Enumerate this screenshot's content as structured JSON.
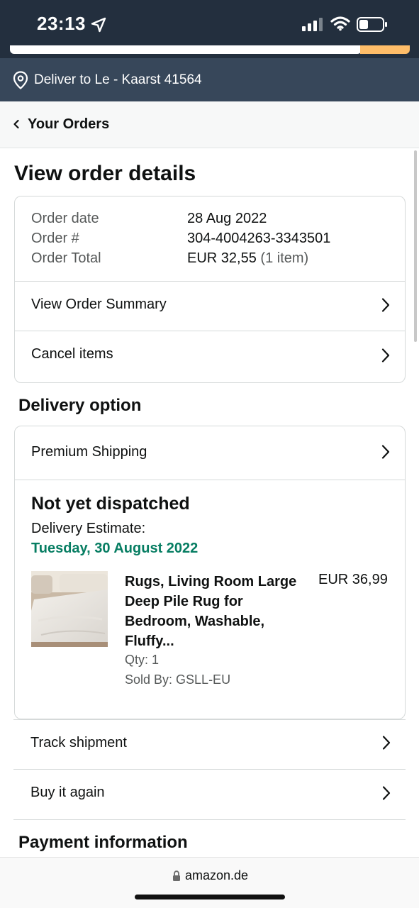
{
  "status_bar": {
    "time": "23:13"
  },
  "deliver": {
    "text": "Deliver to Le - Kaarst 41564"
  },
  "breadcrumb": {
    "label": "Your Orders"
  },
  "page": {
    "title": "View order details"
  },
  "order": {
    "date_label": "Order date",
    "date_value": "28 Aug 2022",
    "number_label": "Order #",
    "number_value": "304-4004263-3343501",
    "total_label": "Order Total",
    "total_value": "EUR 32,55",
    "total_items": "(1 item)",
    "view_summary": "View Order Summary",
    "cancel_items": "Cancel items"
  },
  "delivery": {
    "section_title": "Delivery option",
    "shipping": "Premium Shipping",
    "status": "Not yet dispatched",
    "estimate_label": "Delivery Estimate:",
    "estimate_date": "Tuesday, 30 August 2022",
    "estimate_color": "#067d62"
  },
  "product": {
    "title_line1": "Rugs, Living Room Large",
    "title_line2": "Deep Pile Rug for",
    "title_line3": "Bedroom, Washable,",
    "title_line4": "Fluffy...",
    "price": "EUR 36,99",
    "qty": "Qty: 1",
    "sold_by": "Sold By: GSLL-EU"
  },
  "actions": {
    "track": "Track shipment",
    "buy_again": "Buy it again"
  },
  "payment": {
    "section_title": "Payment information"
  },
  "browser": {
    "url": "amazon.de"
  },
  "colors": {
    "header_dark": "#232f3e",
    "deliver_bar": "#37475a",
    "search_button": "#febd69",
    "border": "#d5d9d9"
  }
}
